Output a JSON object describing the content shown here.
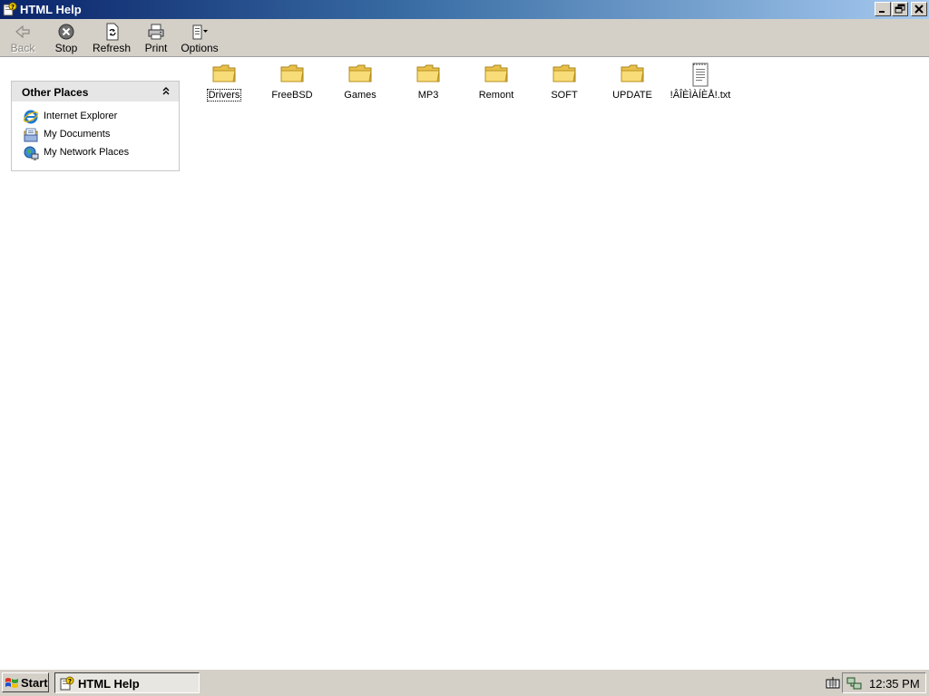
{
  "window": {
    "title": "HTML Help"
  },
  "toolbar": {
    "back_label": "Back",
    "stop_label": "Stop",
    "refresh_label": "Refresh",
    "print_label": "Print",
    "options_label": "Options"
  },
  "other_places": {
    "title": "Other Places",
    "items": [
      {
        "label": "Internet Explorer",
        "icon": "internet-explorer-icon"
      },
      {
        "label": "My Documents",
        "icon": "my-documents-icon"
      },
      {
        "label": "My Network Places",
        "icon": "network-places-icon"
      }
    ]
  },
  "files": [
    {
      "name": "Drivers",
      "type": "folder"
    },
    {
      "name": "FreeBSD",
      "type": "folder"
    },
    {
      "name": "Games",
      "type": "folder"
    },
    {
      "name": "MP3",
      "type": "folder"
    },
    {
      "name": "Remont",
      "type": "folder"
    },
    {
      "name": "SOFT",
      "type": "folder"
    },
    {
      "name": "UPDATE",
      "type": "folder"
    },
    {
      "name": "!ÂÎÈÌÀÍÈÅ!.txt",
      "type": "text-file"
    }
  ],
  "taskbar": {
    "start_label": "Start",
    "task_label": "HTML Help",
    "clock": "12:35 PM"
  },
  "colors": {
    "titlebar_start": "#0a246a",
    "titlebar_end": "#a6caf0",
    "folder_yellow": "#f5d76e",
    "chrome": "#d4d0c8"
  }
}
